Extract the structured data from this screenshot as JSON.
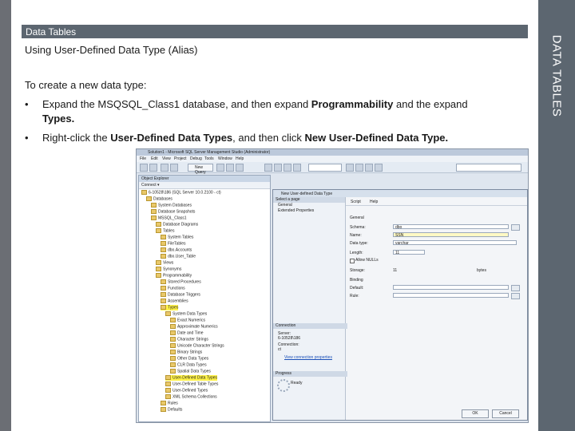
{
  "slide": {
    "section": "Data Tables",
    "side_tab": "DATA TABLES",
    "title": "Using User-Defined Data Type (Alias)",
    "intro": "To create a new data type:",
    "bullet_char": "•",
    "bullet1_part1": "Expand the MSQSQL_Class1 database, and then expand ",
    "bullet1_bold1": "Programmability",
    "bullet1_part2": " and the expand",
    "bullet1_bold2": "Types.",
    "bullet2_part1": "Right-click the ",
    "bullet2_bold1": "User-Defined Data Types",
    "bullet2_part2": ", and then click ",
    "bullet2_bold2": "New User-Defined Data Type."
  },
  "ssms": {
    "window_title": "Solution1 - Microsoft SQL Server Management Studio (Administrator)",
    "menu": [
      "File",
      "Edit",
      "View",
      "Project",
      "Debug",
      "Tools",
      "Window",
      "Help"
    ],
    "new_query": "New Query",
    "object_explorer_title": "Object Explorer",
    "connect_label": "Connect ▾",
    "tree": [
      {
        "label": "6-10528\\186 (SQL Server 10.0.2100 - ct)",
        "level": 0
      },
      {
        "label": "Databases",
        "level": 1
      },
      {
        "label": "System Databases",
        "level": 2
      },
      {
        "label": "Database Snapshots",
        "level": 2
      },
      {
        "label": "MSSQL_Class1",
        "level": 2
      },
      {
        "label": "Database Diagrams",
        "level": 3
      },
      {
        "label": "Tables",
        "level": 3
      },
      {
        "label": "System Tables",
        "level": 4
      },
      {
        "label": "FileTables",
        "level": 4
      },
      {
        "label": "dbo.Accounts",
        "level": 4
      },
      {
        "label": "dbo.User_Table",
        "level": 4
      },
      {
        "label": "Views",
        "level": 3
      },
      {
        "label": "Synonyms",
        "level": 3
      },
      {
        "label": "Programmability",
        "level": 3
      },
      {
        "label": "Stored Procedures",
        "level": 4
      },
      {
        "label": "Functions",
        "level": 4
      },
      {
        "label": "Database Triggers",
        "level": 4
      },
      {
        "label": "Assemblies",
        "level": 4
      },
      {
        "label": "Types",
        "level": 4,
        "highlight": true
      },
      {
        "label": "System Data Types",
        "level": 5
      },
      {
        "label": "Exact Numerics",
        "level": 6
      },
      {
        "label": "Approximate Numerics",
        "level": 6
      },
      {
        "label": "Date and Time",
        "level": 6
      },
      {
        "label": "Character Strings",
        "level": 6
      },
      {
        "label": "Unicode Character Strings",
        "level": 6
      },
      {
        "label": "Binary Strings",
        "level": 6
      },
      {
        "label": "Other Data Types",
        "level": 6
      },
      {
        "label": "CLR Data Types",
        "level": 6
      },
      {
        "label": "Spatial Data Types",
        "level": 6
      },
      {
        "label": "User-Defined Data Types",
        "level": 5,
        "highlight": true
      },
      {
        "label": "User-Defined Table Types",
        "level": 5
      },
      {
        "label": "User-Defined Types",
        "level": 5
      },
      {
        "label": "XML Schema Collections",
        "level": 5
      },
      {
        "label": "Rules",
        "level": 4
      },
      {
        "label": "Defaults",
        "level": 4
      }
    ],
    "dialog": {
      "title": "New User-defined Data Type",
      "select_page": "Select a page",
      "pages": [
        "General",
        "Extended Properties"
      ],
      "script": "Script",
      "help": "Help",
      "general_header": "General",
      "fields": [
        {
          "label": "Schema:",
          "value": "dbo"
        },
        {
          "label": "Name:",
          "value": "SSN"
        },
        {
          "label": "Data type:",
          "value": "varchar"
        },
        {
          "label": "Length:",
          "value": "11"
        },
        {
          "label": "Allow NULLs",
          "value": ""
        },
        {
          "label": "Storage:",
          "value": "11"
        },
        {
          "label": "Binding",
          "value": ""
        },
        {
          "label": "Default:",
          "value": ""
        },
        {
          "label": "Rule:",
          "value": ""
        }
      ],
      "storage_unit": "bytes",
      "connection_header": "Connection",
      "server_label": "Server:",
      "server_value": "6-10528\\186",
      "connection_label": "Connection:",
      "connection_value": "ct",
      "view_connection": "View connection properties",
      "progress_header": "Progress",
      "progress_status": "Ready",
      "ok": "OK",
      "cancel": "Cancel"
    }
  }
}
